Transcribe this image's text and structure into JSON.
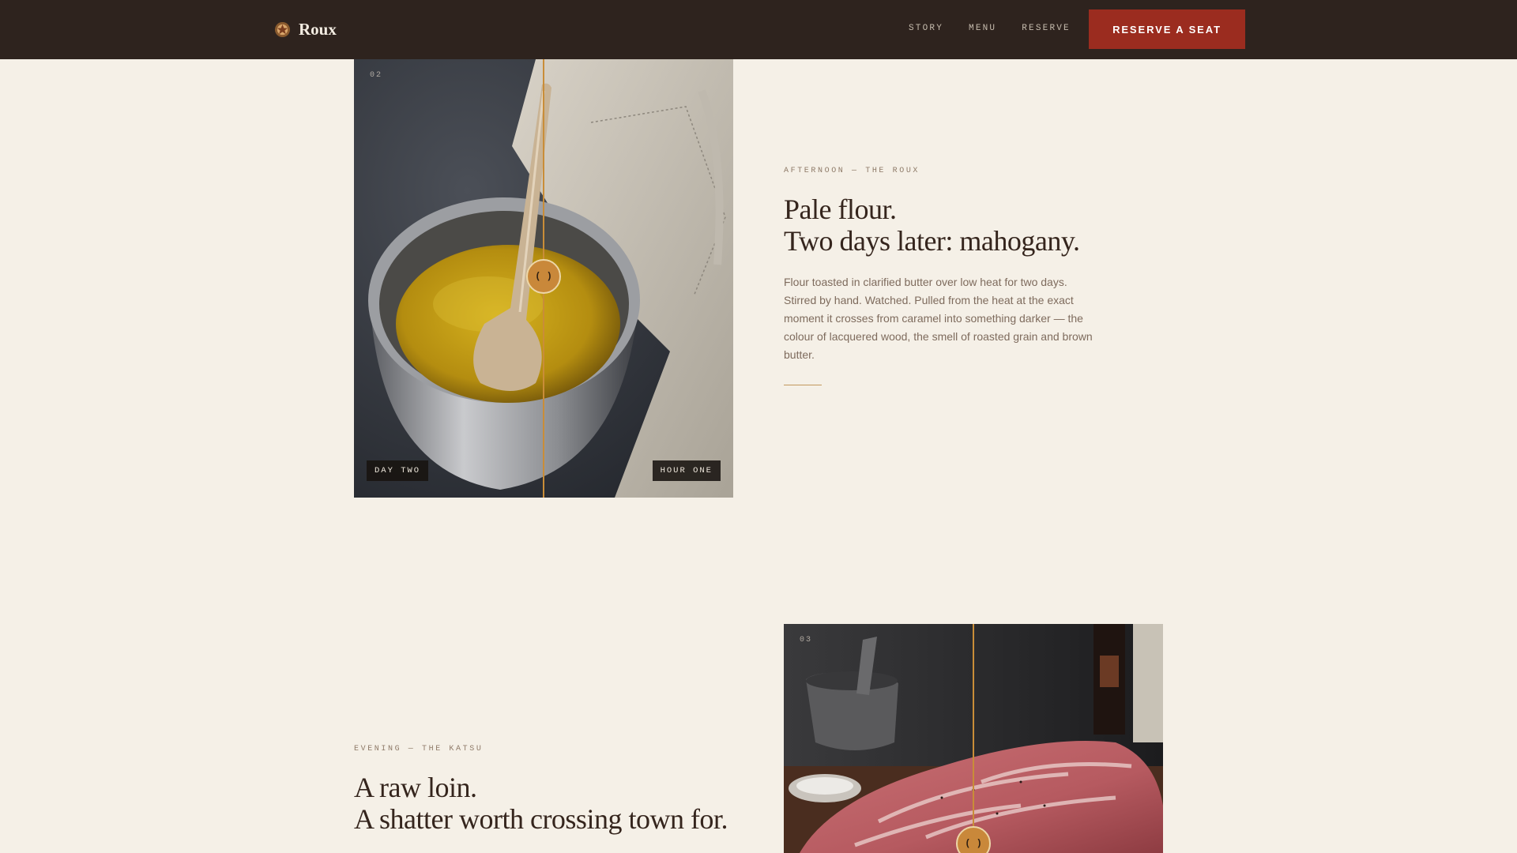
{
  "nav": {
    "brand": "Roux",
    "links": [
      "STORY",
      "MENU",
      "RESERVE"
    ],
    "cta": "RESERVE A SEAT"
  },
  "sections": [
    {
      "index": "02",
      "eyebrow": "AFTERNOON — THE ROUX",
      "headline": [
        "Pale flour.",
        "Two days later: mahogany."
      ],
      "body": "Flour toasted in clarified butter over low heat for two days. Stirred by hand. Watched. Pulled from the heat at the exact moment it crosses from caramel into something darker — the colour of lacquered wood, the smell of roasted grain and brown butter.",
      "tag_left": "DAY TWO",
      "tag_right": "HOUR ONE",
      "handle_glyph": "( )",
      "image_icon": "roux-pot-photo-icon"
    },
    {
      "index": "03",
      "eyebrow": "EVENING — THE KATSU",
      "headline": [
        "A raw loin.",
        "A shatter worth crossing town for."
      ],
      "handle_glyph": "( )",
      "image_icon": "pork-loin-photo-icon"
    }
  ],
  "colors": {
    "page_bg": "#f5f0e7",
    "nav_bg": "#2e231e",
    "cta_bg": "#9b2c1f",
    "accent_gold": "#c9883a"
  }
}
